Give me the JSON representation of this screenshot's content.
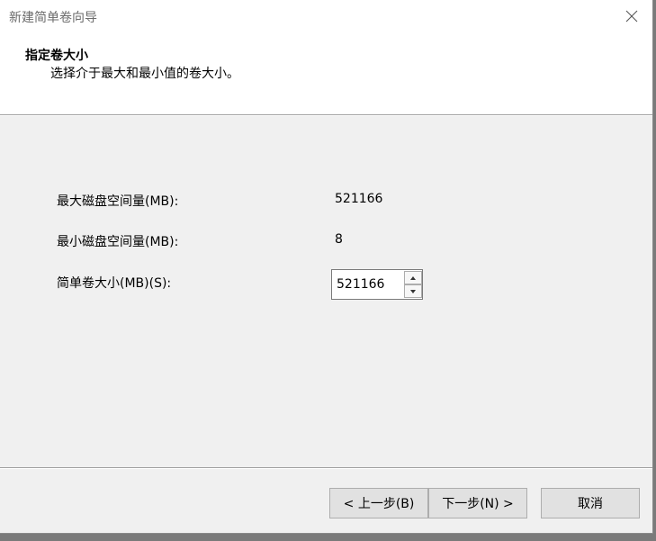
{
  "window": {
    "title": "新建简单卷向导",
    "close_icon": "close-icon"
  },
  "header": {
    "title": "指定卷大小",
    "subtitle": "选择介于最大和最小值的卷大小。"
  },
  "fields": {
    "max_label": "最大磁盘空间量(MB):",
    "max_value": "521166",
    "min_label": "最小磁盘空间量(MB):",
    "min_value": "8",
    "size_label": "简单卷大小(MB)(S):",
    "size_value": "521166"
  },
  "buttons": {
    "back": "< 上一步(B)",
    "next": "下一步(N) >",
    "cancel": "取消"
  }
}
